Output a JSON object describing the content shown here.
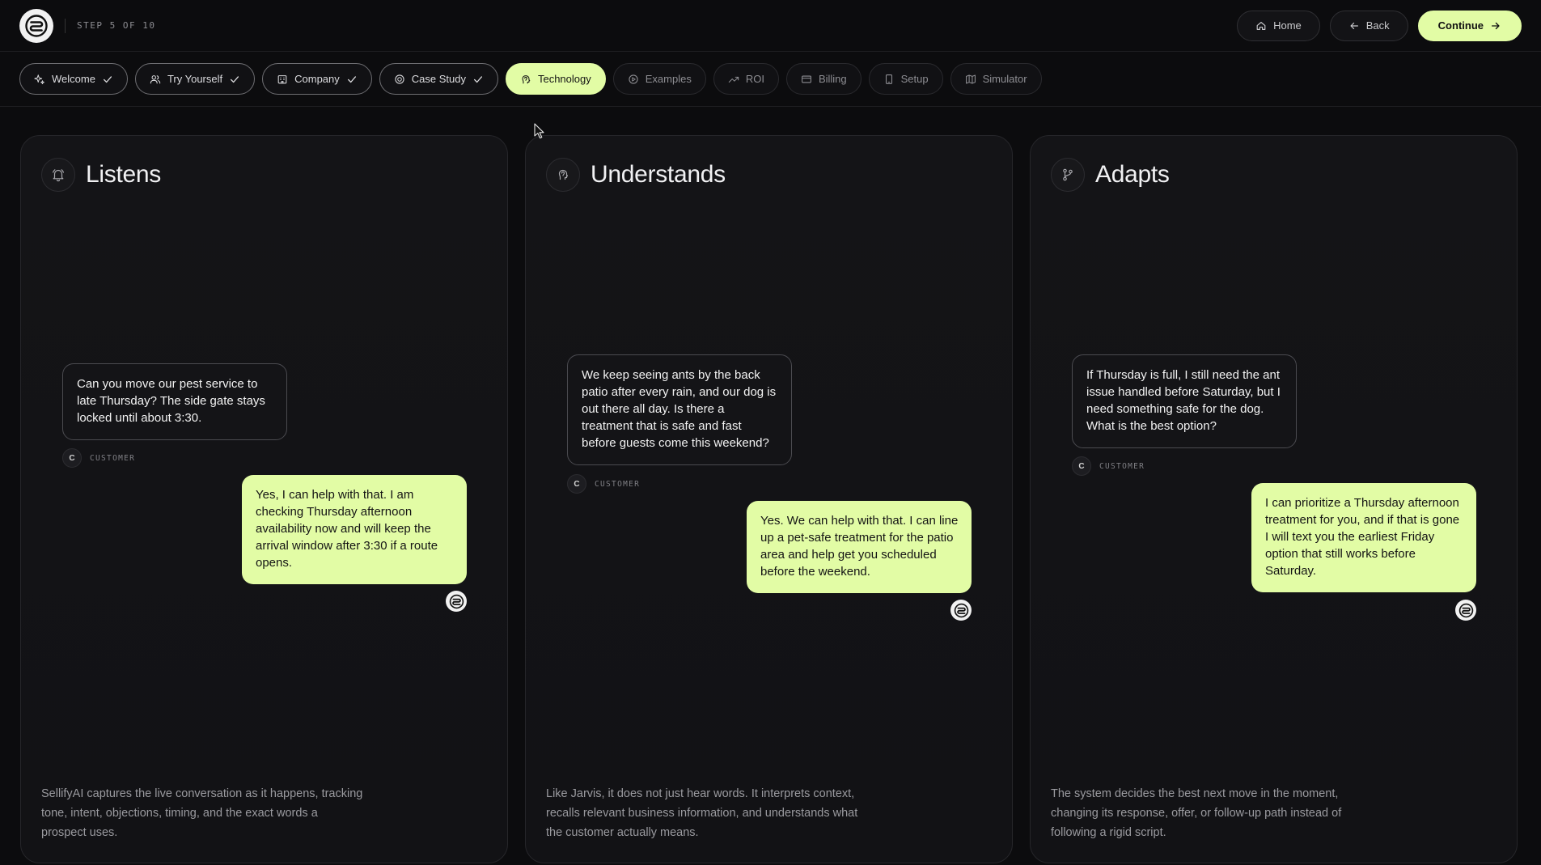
{
  "header": {
    "step_text": "STEP 5 OF 10",
    "home_label": "Home",
    "back_label": "Back",
    "continue_label": "Continue"
  },
  "tabs": [
    {
      "label": "Welcome",
      "icon": "sparkle-icon",
      "state": "done"
    },
    {
      "label": "Try Yourself",
      "icon": "users-icon",
      "state": "done"
    },
    {
      "label": "Company",
      "icon": "building-icon",
      "state": "done"
    },
    {
      "label": "Case Study",
      "icon": "coin-icon",
      "state": "done"
    },
    {
      "label": "Technology",
      "icon": "brain-icon",
      "state": "active"
    },
    {
      "label": "Examples",
      "icon": "play-circle-icon",
      "state": "default"
    },
    {
      "label": "ROI",
      "icon": "trend-up-icon",
      "state": "default"
    },
    {
      "label": "Billing",
      "icon": "card-icon",
      "state": "default"
    },
    {
      "label": "Setup",
      "icon": "phone-icon",
      "state": "default"
    },
    {
      "label": "Simulator",
      "icon": "map-icon",
      "state": "default"
    }
  ],
  "cards": [
    {
      "title": "Listens",
      "icon": "bell-icon",
      "customer_message": "Can you move our pest service to late Thursday? The side gate stays locked until about 3:30.",
      "customer_initial": "C",
      "customer_label": "CUSTOMER",
      "agent_message": "Yes, I can help with that. I am checking Thursday afternoon availability now and will keep the arrival window after 3:30 if a route opens.",
      "description": "SellifyAI captures the live conversation as it happens, tracking tone, intent, objections, timing, and the exact words a prospect uses."
    },
    {
      "title": "Understands",
      "icon": "brain-icon",
      "customer_message": "We keep seeing ants by the back patio after every rain, and our dog is out there all day. Is there a treatment that is safe and fast before guests come this weekend?",
      "customer_initial": "C",
      "customer_label": "CUSTOMER",
      "agent_message": "Yes. We can help with that. I can line up a pet-safe treatment for the patio area and help get you scheduled before the weekend.",
      "description": "Like Jarvis, it does not just hear words. It interprets context, recalls relevant business information, and understands what the customer actually means."
    },
    {
      "title": "Adapts",
      "icon": "branch-icon",
      "customer_message": "If Thursday is full, I still need the ant issue handled before Saturday, but I need something safe for the dog. What is the best option?",
      "customer_initial": "C",
      "customer_label": "CUSTOMER",
      "agent_message": "I can prioritize a Thursday afternoon treatment for you, and if that is gone I will text you the earliest Friday option that still works before Saturday.",
      "description": "The system decides the best next move in the moment, changing its response, offer, or follow-up path instead of following a rigid script."
    }
  ]
}
